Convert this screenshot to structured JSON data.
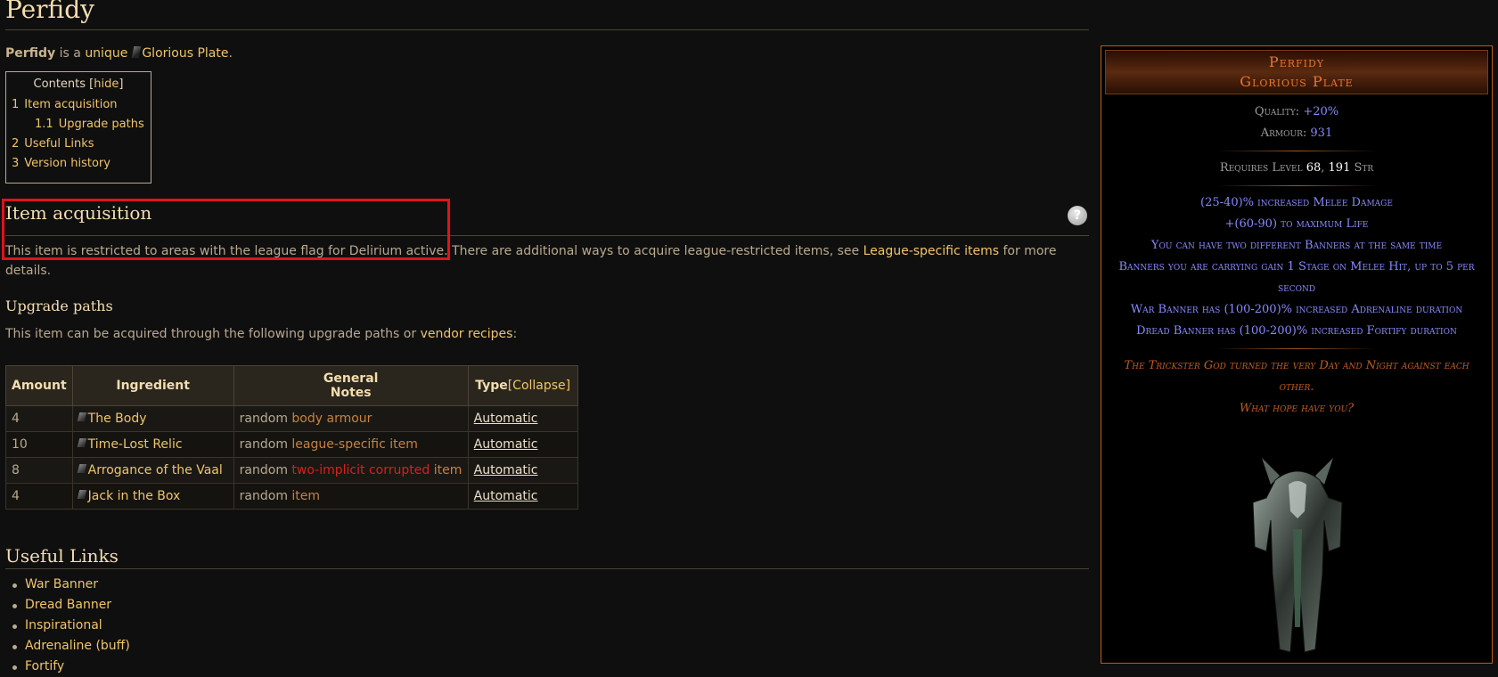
{
  "page": {
    "title": "Perfidy"
  },
  "intro": {
    "name": "Perfidy",
    "is_a": " is a ",
    "unique": "unique",
    "base": "Glorious Plate",
    "end": "."
  },
  "toc": {
    "title": "Contents",
    "toggle": "hide",
    "items": [
      {
        "num": "1",
        "label": "Item acquisition"
      },
      {
        "num": "1.1",
        "label": "Upgrade paths"
      },
      {
        "num": "2",
        "label": "Useful Links"
      },
      {
        "num": "3",
        "label": "Version history"
      }
    ]
  },
  "acquisition": {
    "heading": "Item acquisition",
    "help_glyph": "?",
    "text_a": "This item is restricted to areas with the league flag for Delirium active. There are additional ways to acquire league-restricted items, see ",
    "link": "League-specific items",
    "text_b": " for more details."
  },
  "upgrade": {
    "heading": "Upgrade paths",
    "text": "This item can be acquired through the following upgrade paths or ",
    "link": "vendor recipes",
    "text_end": ":",
    "headers": {
      "amount": "Amount",
      "ingredient": "Ingredient",
      "notes_a": "General",
      "notes_b": "Notes",
      "type": "Type",
      "collapse": "[Collapse]"
    },
    "rows": [
      {
        "amount": "4",
        "ingredient": "The Body",
        "prefix": "random ",
        "note": "body armour",
        "note_red": "",
        "note_tail": "",
        "type": "Automatic"
      },
      {
        "amount": "10",
        "ingredient": "Time-Lost Relic",
        "prefix": "random ",
        "note": "league-specific item",
        "note_red": "",
        "note_tail": "",
        "type": "Automatic"
      },
      {
        "amount": "8",
        "ingredient": "Arrogance of the Vaal",
        "prefix": "random ",
        "note": "",
        "note_red": "two-implicit corrupted",
        "note_tail": " item",
        "type": "Automatic"
      },
      {
        "amount": "4",
        "ingredient": "Jack in the Box",
        "prefix": "random ",
        "note": "item",
        "note_red": "",
        "note_tail": "",
        "type": "Automatic"
      }
    ]
  },
  "useful_links": {
    "heading": "Useful Links",
    "items": [
      "War Banner",
      "Dread Banner",
      "Inspirational",
      "Adrenaline (buff)",
      "Fortify"
    ]
  },
  "item": {
    "name": "Perfidy",
    "base": "Glorious Plate",
    "quality_label": "Quality: ",
    "quality": "+20%",
    "armour_label": "Armour: ",
    "armour": "931",
    "req_label": "Requires Level ",
    "req_level": "68",
    "req_sep": ", ",
    "req_str": "191",
    "req_str_label": " Str",
    "mods": [
      "(25-40)% increased Melee Damage",
      "+(60-90) to maximum Life",
      "You can have two different Banners at the same time",
      "Banners you are carrying gain 1 Stage on Melee Hit, up to 5 per second",
      "War Banner has (100-200)% increased Adrenaline duration",
      "Dread Banner has (100-200)% increased Fortify duration"
    ],
    "flavour": [
      "The Trickster God turned the very Day and Night against each other.",
      "What hope have you?"
    ],
    "colors": {
      "unique": "#e6762d",
      "magic_mod": "#8888ff",
      "flavour": "#c35a1c",
      "border": "#c35a1c"
    }
  }
}
